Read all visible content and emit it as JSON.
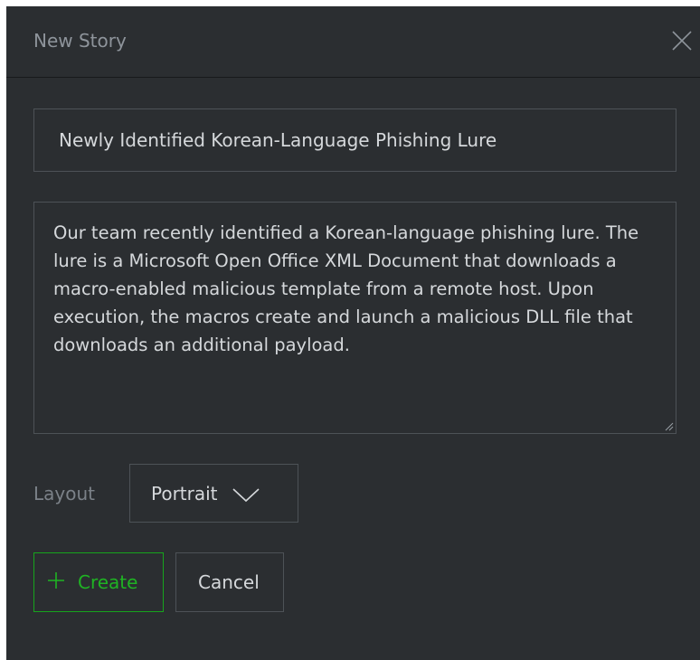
{
  "dialog": {
    "title": "New Story",
    "close_icon": "close-icon"
  },
  "form": {
    "title_value": "Newly Identified Korean-Language Phishing Lure",
    "description_value": "Our team recently identified a Korean-language phishing lure. The lure is a Microsoft Open Office XML Document that downloads a macro-enabled malicious template from a remote host. Upon execution, the macros create and launch a malicious DLL file that downloads an additional payload.",
    "layout_label": "Layout",
    "layout_value": "Portrait",
    "layout_icon": "chevron-down-icon"
  },
  "actions": {
    "create_label": "Create",
    "create_icon": "plus-icon",
    "cancel_label": "Cancel"
  },
  "colors": {
    "background": "#2b2e31",
    "accent_green": "#1fb323",
    "border": "#4d5257",
    "text": "#d5d8db",
    "muted_text": "#8e949b"
  }
}
